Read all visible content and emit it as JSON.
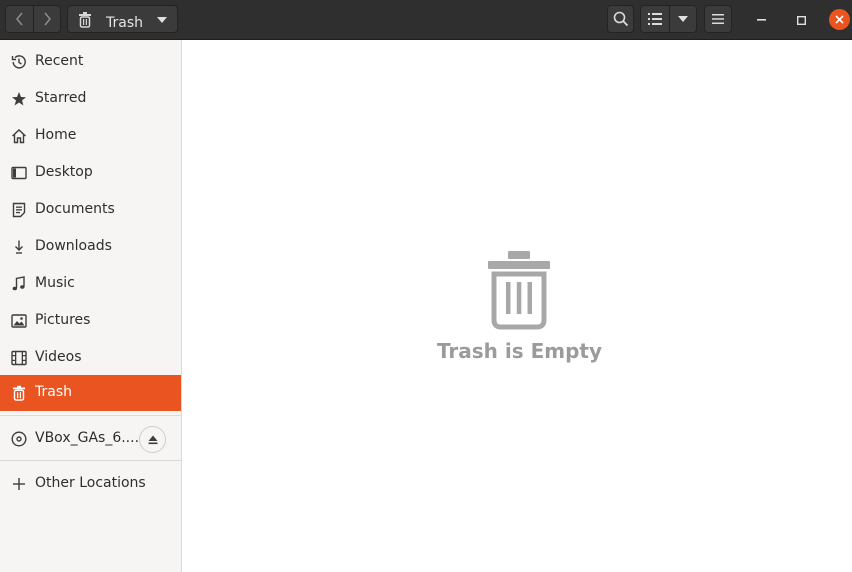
{
  "header": {
    "location_label": "Trash",
    "icons": {
      "back": "chevron-left-icon",
      "forward": "chevron-right-icon",
      "location": "trash-icon",
      "location_menu": "caret-down-icon",
      "search": "search-icon",
      "view": "list-view-icon",
      "view_menu": "caret-down-icon",
      "menu": "hamburger-menu-icon",
      "minimize": "minimize-icon",
      "maximize": "maximize-icon",
      "close": "close-icon"
    },
    "close_color": "#e95420"
  },
  "sidebar": {
    "items": [
      {
        "label": "Recent",
        "icon": "clock-icon"
      },
      {
        "label": "Starred",
        "icon": "star-icon"
      },
      {
        "label": "Home",
        "icon": "home-icon"
      },
      {
        "label": "Desktop",
        "icon": "desktop-icon"
      },
      {
        "label": "Documents",
        "icon": "document-icon"
      },
      {
        "label": "Downloads",
        "icon": "download-icon"
      },
      {
        "label": "Music",
        "icon": "music-icon"
      },
      {
        "label": "Pictures",
        "icon": "picture-icon"
      },
      {
        "label": "Videos",
        "icon": "video-icon"
      },
      {
        "label": "Trash",
        "icon": "trash-icon",
        "active": true
      }
    ],
    "devices": [
      {
        "label": "VBox_GAs_6....",
        "icon": "disc-icon",
        "action_icon": "eject-icon"
      }
    ],
    "other": {
      "label": "Other Locations",
      "icon": "plus-icon"
    },
    "accent_color": "#e95420"
  },
  "main": {
    "empty_state": {
      "icon": "trash-icon",
      "label": "Trash is Empty"
    }
  }
}
